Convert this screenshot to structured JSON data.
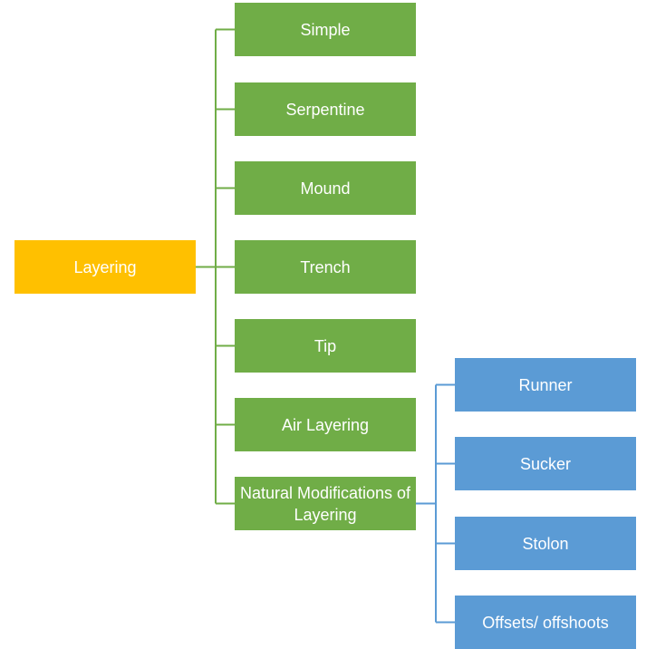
{
  "diagram": {
    "root": {
      "label": "Layering",
      "color": "#ffc000"
    },
    "children": [
      {
        "label": "Simple"
      },
      {
        "label": "Serpentine"
      },
      {
        "label": "Mound"
      },
      {
        "label": "Trench"
      },
      {
        "label": "Tip"
      },
      {
        "label": "Air Layering"
      },
      {
        "label": "Natural Modifications of Layering"
      }
    ],
    "child_color": "#70ad47",
    "sub_children": [
      {
        "label": "Runner"
      },
      {
        "label": "Sucker"
      },
      {
        "label": "Stolon"
      },
      {
        "label": "Offsets/ offshoots"
      }
    ],
    "sub_child_color": "#5b9bd5"
  }
}
